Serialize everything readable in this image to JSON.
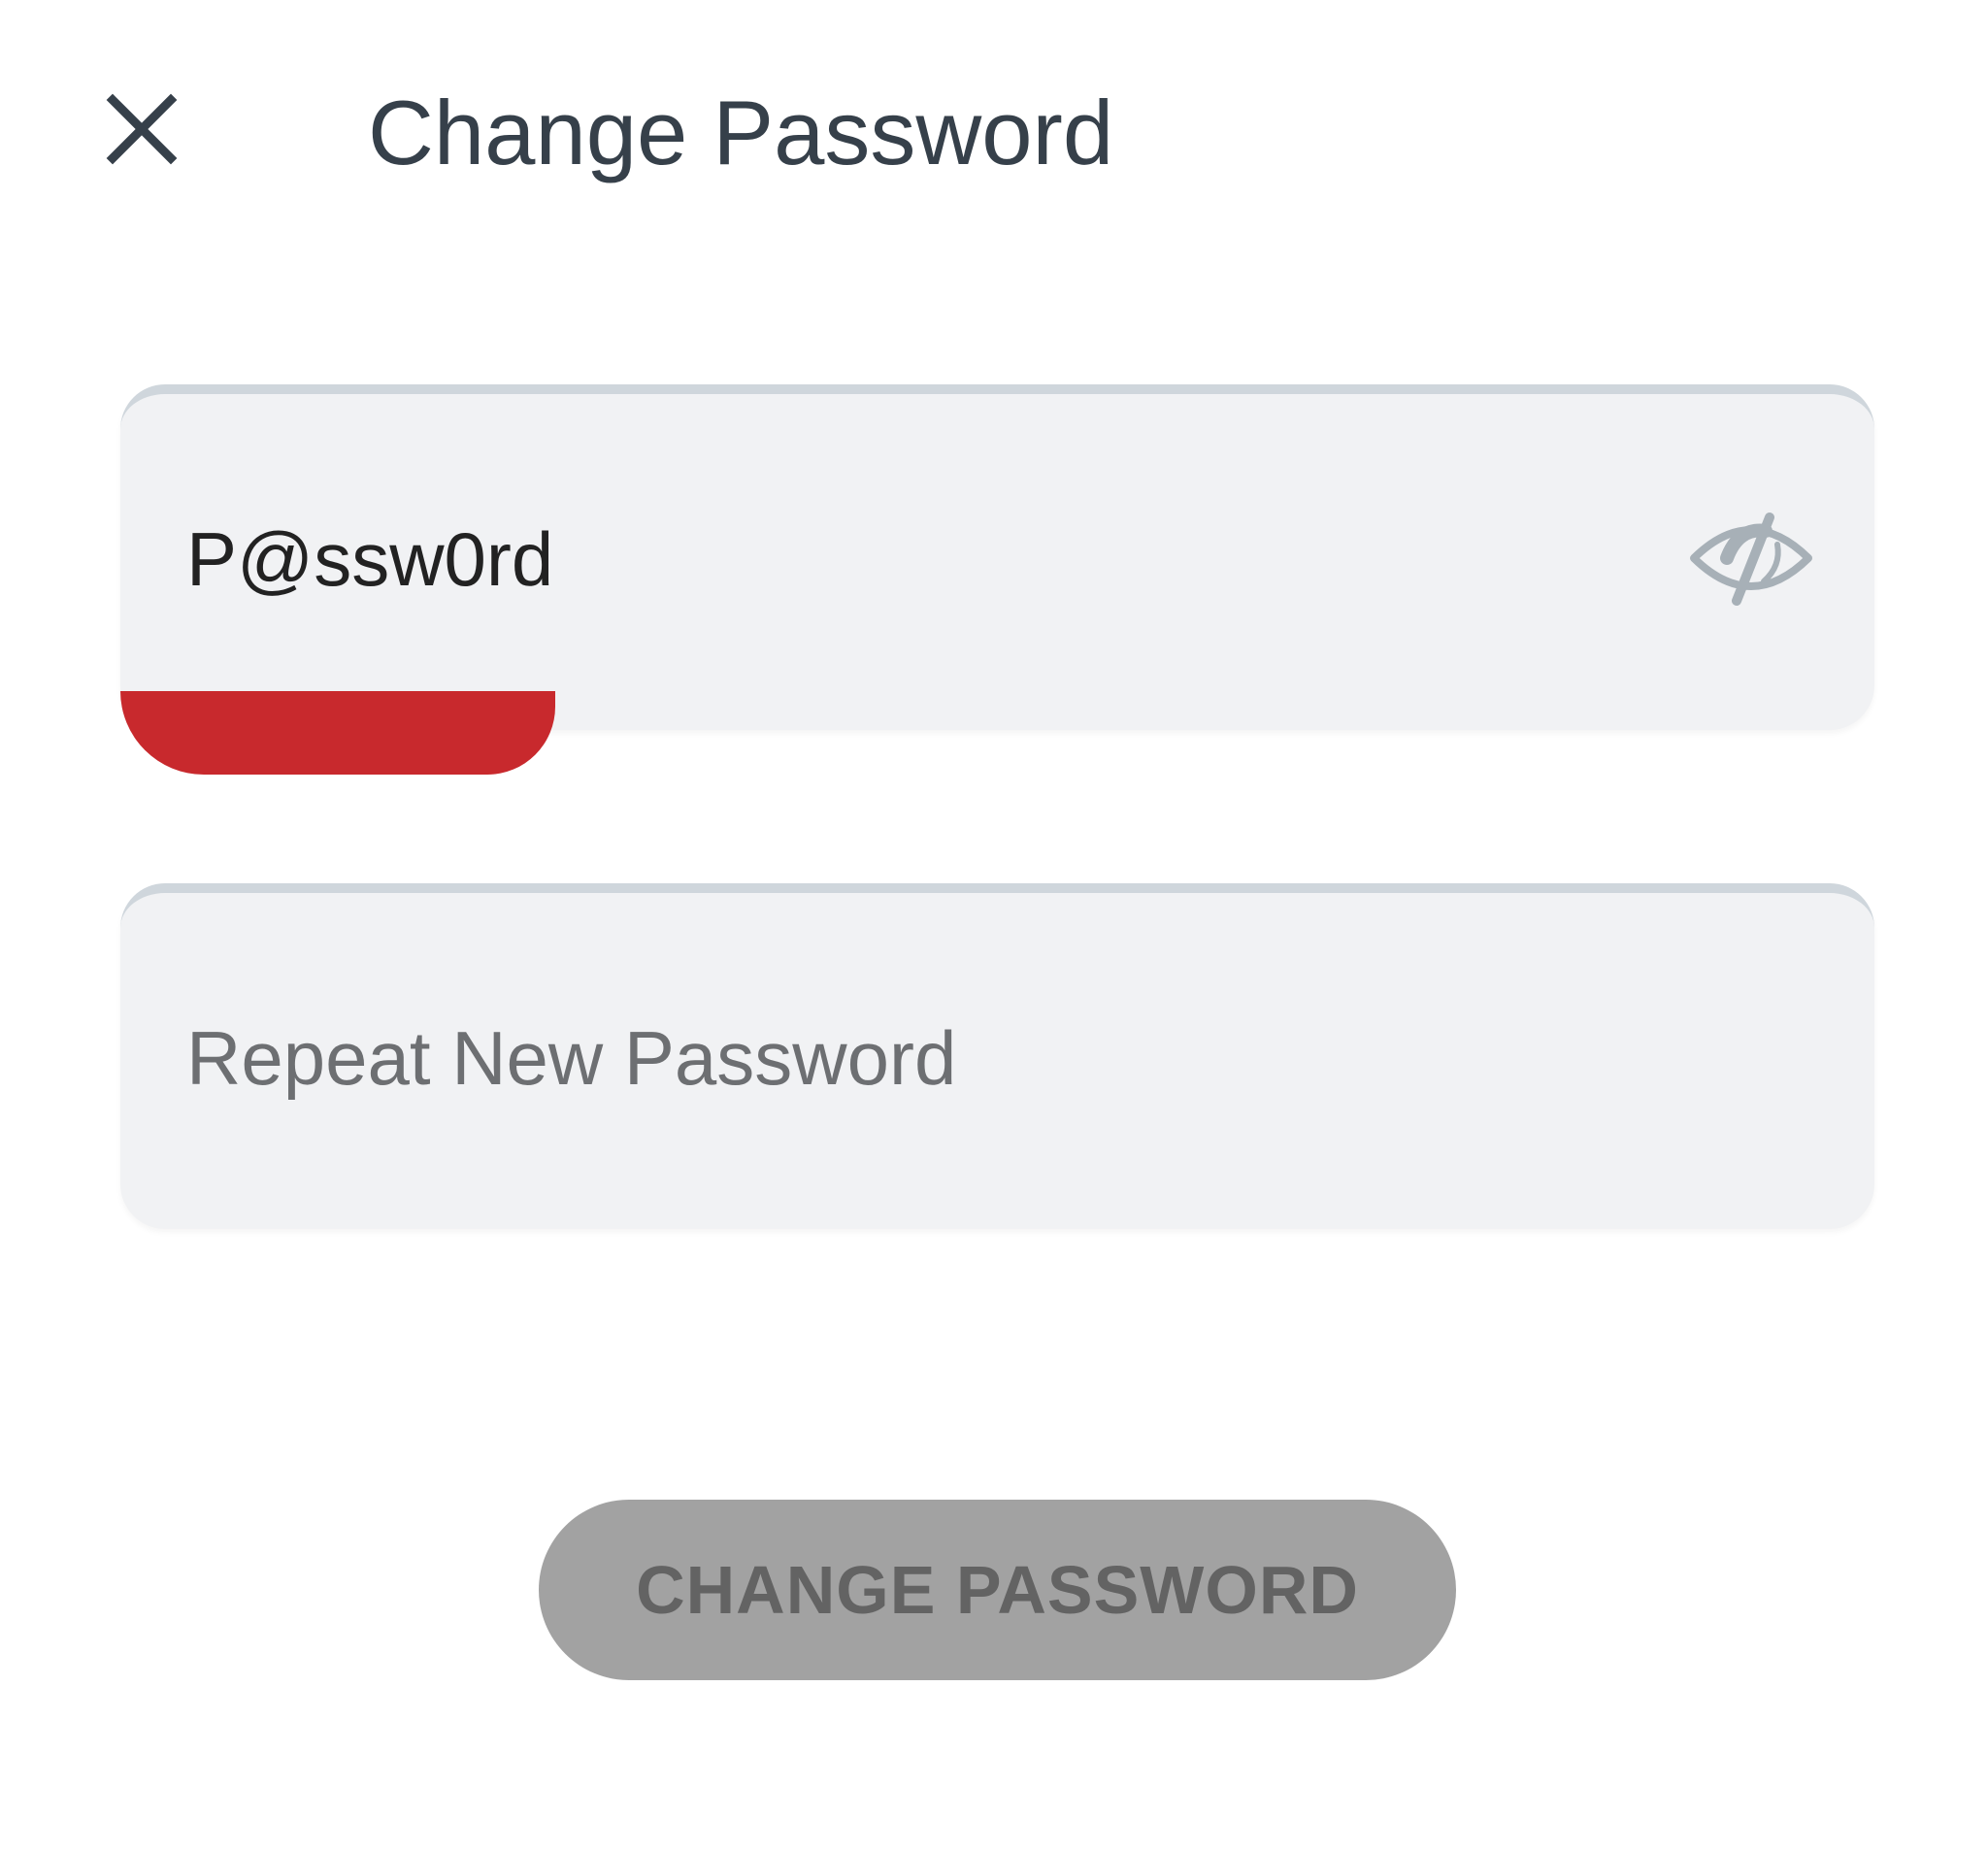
{
  "header": {
    "title": "Change Password",
    "close_icon": "close-icon"
  },
  "form": {
    "new_password": {
      "value": "P@ssw0rd",
      "visibility_icon": "eye-slash-icon",
      "strength_color": "#c8292d"
    },
    "repeat_password": {
      "value": "",
      "placeholder": "Repeat New Password"
    }
  },
  "actions": {
    "submit_label": "CHANGE PASSWORD",
    "submit_state": "disabled"
  },
  "colors": {
    "title": "#36404a",
    "field_bg": "#f1f2f4",
    "field_border": "#cfd6dc",
    "weak_indicator": "#c8292d",
    "disabled_button": "#a2a2a2",
    "disabled_button_text": "#636363"
  }
}
